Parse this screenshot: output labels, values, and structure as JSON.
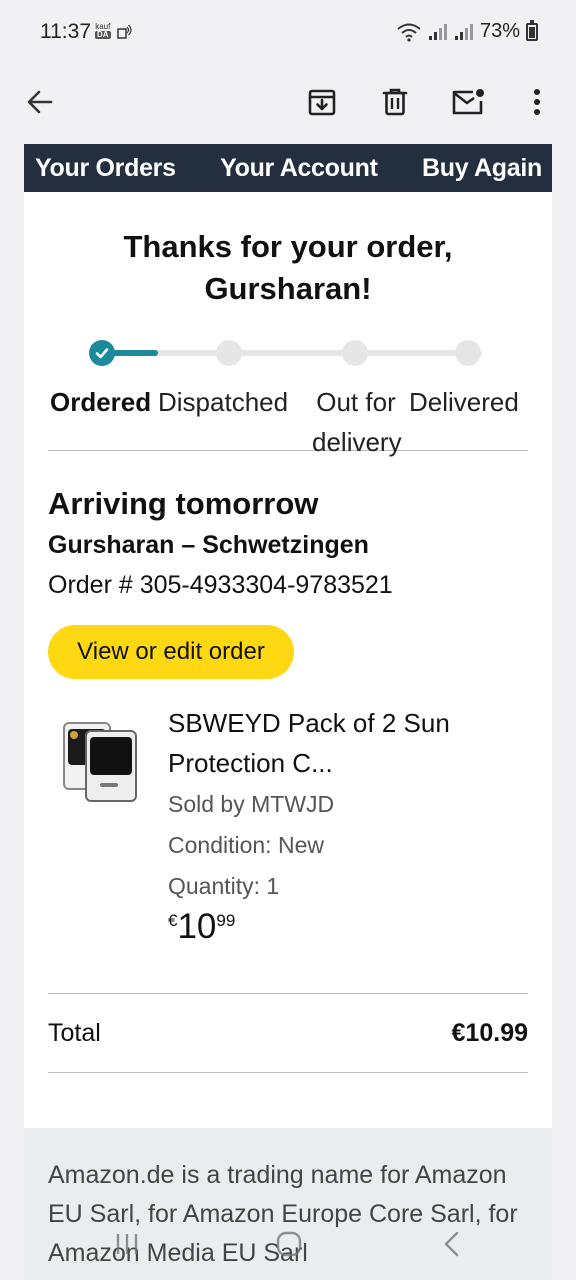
{
  "status_bar": {
    "time": "11:37",
    "badge_top": "kauf",
    "badge_bottom": "DA",
    "battery": "73%"
  },
  "toolbar": {
    "icons": [
      "back-arrow-icon",
      "archive-icon",
      "delete-icon",
      "mark-unread-icon",
      "more-options-icon"
    ]
  },
  "email": {
    "nav": {
      "orders": "Your Orders",
      "account": "Your Account",
      "buy_again": "Buy Again"
    },
    "thanks_line1": "Thanks for your order,",
    "thanks_line2": "Gursharan!",
    "progress": {
      "current_step": 1,
      "steps": [
        "Ordered",
        "Dispatched",
        "Out for delivery",
        "Delivered"
      ]
    },
    "arriving": "Arriving tomorrow",
    "ship_to": "Gursharan – Schwetzingen",
    "order_number": "Order # 305-4933304-9783521",
    "view_button": "View or edit order",
    "item": {
      "title": "SBWEYD Pack of 2 Sun Protection C...",
      "sold_by": "Sold by MTWJD",
      "condition": "Condition: New",
      "quantity": "Quantity: 1",
      "price_currency": "€",
      "price_whole": "10",
      "price_fraction": "99"
    },
    "total_label": "Total",
    "total_value": "€10.99",
    "footer_text": "Amazon.de is a trading name for Amazon EU Sarl, for Amazon Europe Core Sarl, for Amazon Media EU Sarl"
  },
  "colors": {
    "nav_bg": "#232f3e",
    "progress_accent": "#1a8a9c",
    "button_yellow": "#ffd814",
    "footer_bg": "#eaedef"
  }
}
